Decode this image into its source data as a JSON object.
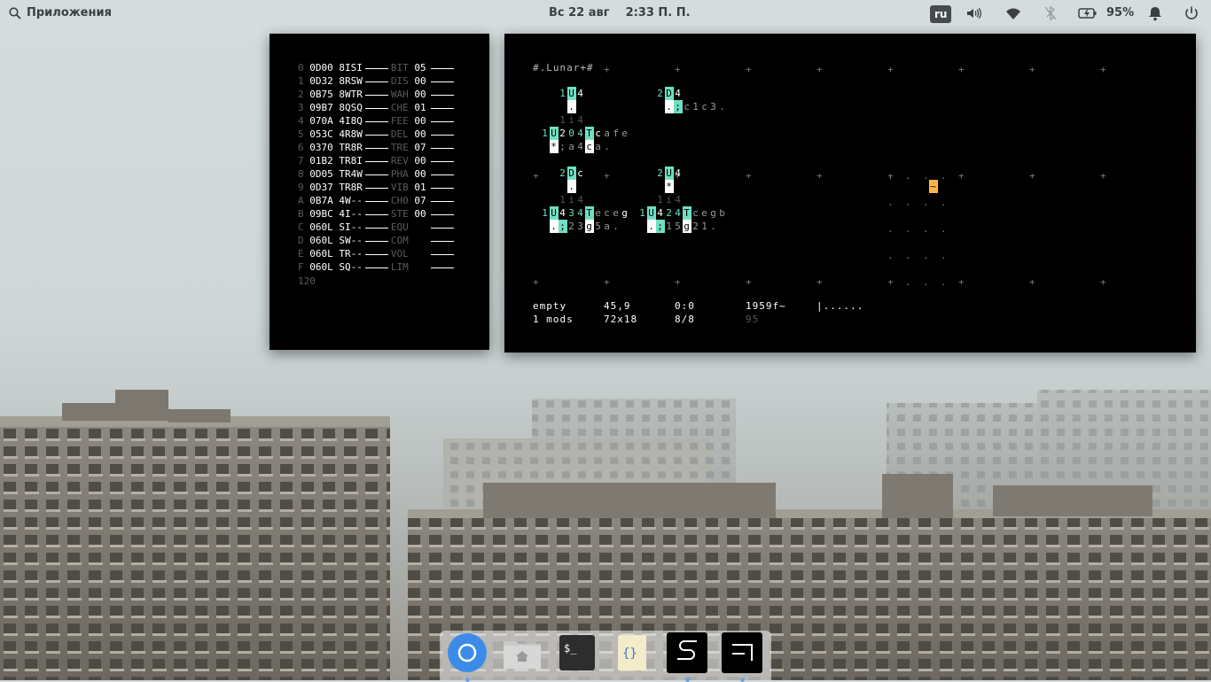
{
  "panel": {
    "applications_label": "Приложения",
    "clock_date": "Вс 22 авг",
    "clock_time": "2:33 П. П.",
    "keyboard_layout": "ru",
    "battery_percent": "95%",
    "icons": [
      "search-icon",
      "volume-icon",
      "wifi-icon",
      "bluetooth-off-icon",
      "battery-icon",
      "notifications-bell-icon",
      "power-icon"
    ]
  },
  "tracker": {
    "rows": [
      {
        "idx": "0",
        "addr": "0D00",
        "code": "8ISI",
        "param": "BIT",
        "val": "05"
      },
      {
        "idx": "1",
        "addr": "0D32",
        "code": "8RSW",
        "param": "DIS",
        "val": "00"
      },
      {
        "idx": "2",
        "addr": "0B75",
        "code": "8WTR",
        "param": "WAH",
        "val": "00"
      },
      {
        "idx": "3",
        "addr": "09B7",
        "code": "8QSQ",
        "param": "CHE",
        "val": "01"
      },
      {
        "idx": "4",
        "addr": "070A",
        "code": "4I8Q",
        "param": "FEE",
        "val": "00"
      },
      {
        "idx": "5",
        "addr": "053C",
        "code": "4R8W",
        "param": "DEL",
        "val": "00"
      },
      {
        "idx": "6",
        "addr": "0370",
        "code": "TR8R",
        "param": "TRE",
        "val": "07"
      },
      {
        "idx": "7",
        "addr": "01B2",
        "code": "TR8I",
        "param": "REV",
        "val": "00"
      },
      {
        "idx": "8",
        "addr": "0D05",
        "code": "TR4W",
        "param": "PHA",
        "val": "00"
      },
      {
        "idx": "9",
        "addr": "0D37",
        "code": "TR8R",
        "param": "VIB",
        "val": "01"
      },
      {
        "idx": "A",
        "addr": "0B7A",
        "code": "4W--",
        "param": "CHO",
        "val": "07"
      },
      {
        "idx": "B",
        "addr": "09BC",
        "code": "4I--",
        "param": "STE",
        "val": "00"
      },
      {
        "idx": "C",
        "addr": "060L",
        "code": "SI--",
        "param": "EQU",
        "val": ""
      },
      {
        "idx": "D",
        "addr": "060L",
        "code": "SW--",
        "param": "COM",
        "val": ""
      },
      {
        "idx": "E",
        "addr": "060L",
        "code": "TR--",
        "param": "VOL",
        "val": ""
      },
      {
        "idx": "F",
        "addr": "060L",
        "code": "SQ--",
        "param": "LIM",
        "val": ""
      }
    ],
    "bpm": "120"
  },
  "orca": {
    "title": "#.Lunar+#",
    "status": {
      "file": "empty",
      "pos": "45,9",
      "sel": "0:0",
      "frame": "1959f~",
      "bar": "|......",
      "mods": "1 mods",
      "grid": "72x18",
      "scale": "8/8",
      "bpm": "95"
    },
    "orange_glyph": "~",
    "g1": "1U4",
    "g1_sub": ".",
    "g2": "2D4",
    "g2_sub": ".;c1c3.",
    "g3_top": "1i4",
    "g3": "1U204Tcafe",
    "g3_sub": "*;a4c a.",
    "g4": "2Dc",
    "g4_sub": ".",
    "g5": "2U4",
    "g5_sub": "*",
    "g6_top": "1i4",
    "g6": "1U434Tceceg",
    "g6_sub": ".;23g5a.",
    "g7_top": "1i4",
    "g7": "1U424Tcegb",
    "g7_sub": ".;15g21."
  },
  "dock": {
    "apps": [
      "web-browser-icon",
      "files-icon",
      "terminal-icon",
      "code-editor-icon",
      "orca-app-icon",
      "left-app-icon"
    ]
  }
}
